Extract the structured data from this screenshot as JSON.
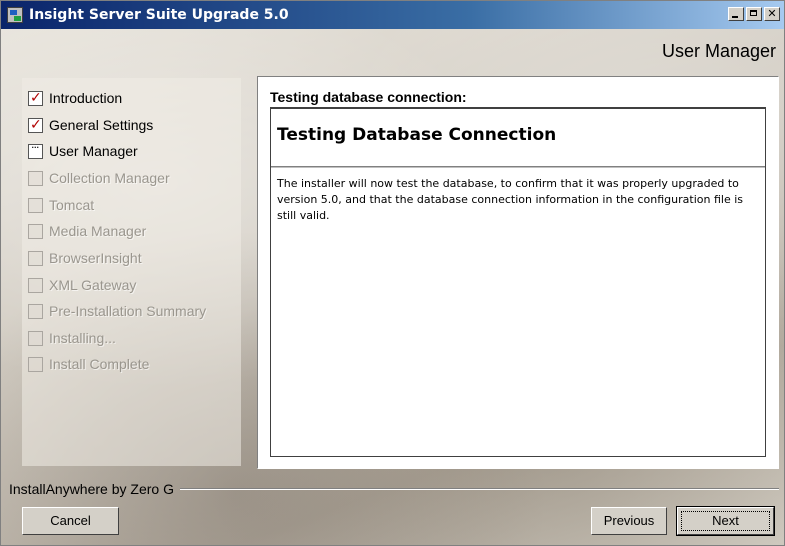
{
  "window": {
    "title": "Insight Server Suite Upgrade 5.0"
  },
  "step_title": "User Manager",
  "steps": [
    {
      "label": "Introduction",
      "state": "done"
    },
    {
      "label": "General Settings",
      "state": "done"
    },
    {
      "label": "User Manager",
      "state": "current"
    },
    {
      "label": "Collection Manager",
      "state": "pending"
    },
    {
      "label": "Tomcat",
      "state": "pending"
    },
    {
      "label": "Media Manager",
      "state": "pending"
    },
    {
      "label": "BrowserInsight",
      "state": "pending"
    },
    {
      "label": "XML Gateway",
      "state": "pending"
    },
    {
      "label": "Pre-Installation Summary",
      "state": "pending"
    },
    {
      "label": "Installing...",
      "state": "pending"
    },
    {
      "label": "Install Complete",
      "state": "pending"
    }
  ],
  "panel": {
    "header": "Testing database connection:",
    "inner_title": "Testing Database Connection",
    "body": "The installer will now test the database, to confirm that it was properly upgraded to version 5.0, and that the database connection information in the configuration file is still valid."
  },
  "footer": {
    "brand": "InstallAnywhere by Zero G",
    "cancel_label": "Cancel",
    "previous_label": "Previous",
    "next_label": "Next"
  },
  "colors": {
    "titlebar_start": "#0a246a",
    "titlebar_end": "#a6caf0",
    "check_mark": "#b00000",
    "pending_text": "#9a968e"
  },
  "icons": {
    "app": "installer-app-icon",
    "minimize": "minimize-icon",
    "maximize": "maximize-icon",
    "close": "close-icon",
    "done_step": "checkmark-icon",
    "current_step": "ellipsis-icon"
  }
}
